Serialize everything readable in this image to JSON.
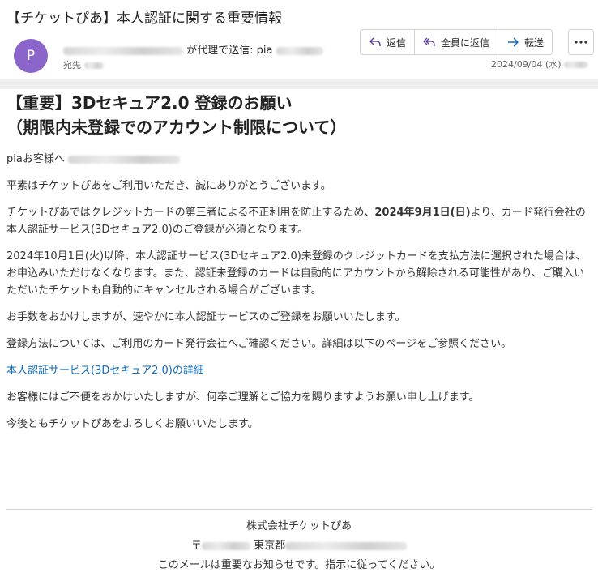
{
  "subject": "【チケットぴあ】本人認証に関する重要情報",
  "sender": {
    "avatar_letter": "P",
    "via_text": "が代理で送信: pia",
    "to_label": "宛先"
  },
  "actions": {
    "reply": "返信",
    "reply_all": "全員に返信",
    "forward": "転送"
  },
  "date": "2024/09/04 (水)",
  "body": {
    "heading_line1": "【重要】3Dセキュア2.0 登録のお願い",
    "heading_line2": "（期限内未登録でのアカウント制限について）",
    "greeting": "piaお客様へ",
    "p1": "平素はチケットぴあをご利用いただき、誠にありがとうございます。",
    "p2_pre": "チケットぴあではクレジットカードの第三者による不正利用を防止するため、",
    "p2_bold": "2024年9月1日(日)",
    "p2_post": "より、カード発行会社の本人認証サービス(3Dセキュア2.0)のご登録が必須となります。",
    "p3": "2024年10月1日(火)以降、本人認証サービス(3Dセキュア2.0)未登録のクレジットカードを支払方法に選択された場合は、お申込みいただけなくなります。また、認証未登録のカードは自動的にアカウントから解除される可能性があり、ご購入いただいたチケットも自動的にキャンセルされる場合がございます。",
    "p4": "お手数をおかけしますが、速やかに本人認証サービスのご登録をお願いいたします。",
    "p5": "登録方法については、ご利用のカード発行会社へご確認ください。詳細は以下のページをご参照ください。",
    "link": "本人認証サービス(3Dセキュア2.0)の詳細",
    "p6": "お客様にはご不便をおかけいたしますが、何卒ご理解とご協力を賜りますようお願い申し上げます。",
    "p7": "今後ともチケットぴあをよろしくお願いいたします。"
  },
  "footer": {
    "company": "株式会社チケットぴあ",
    "address_prefix": "〒",
    "address_city": "東京都",
    "notice": "このメールは重要なお知らせです。指示に従ってください。"
  },
  "colors": {
    "avatar": "#8b65c9",
    "link": "#0f6cbd",
    "accent_icon": "#5b3e9e"
  }
}
